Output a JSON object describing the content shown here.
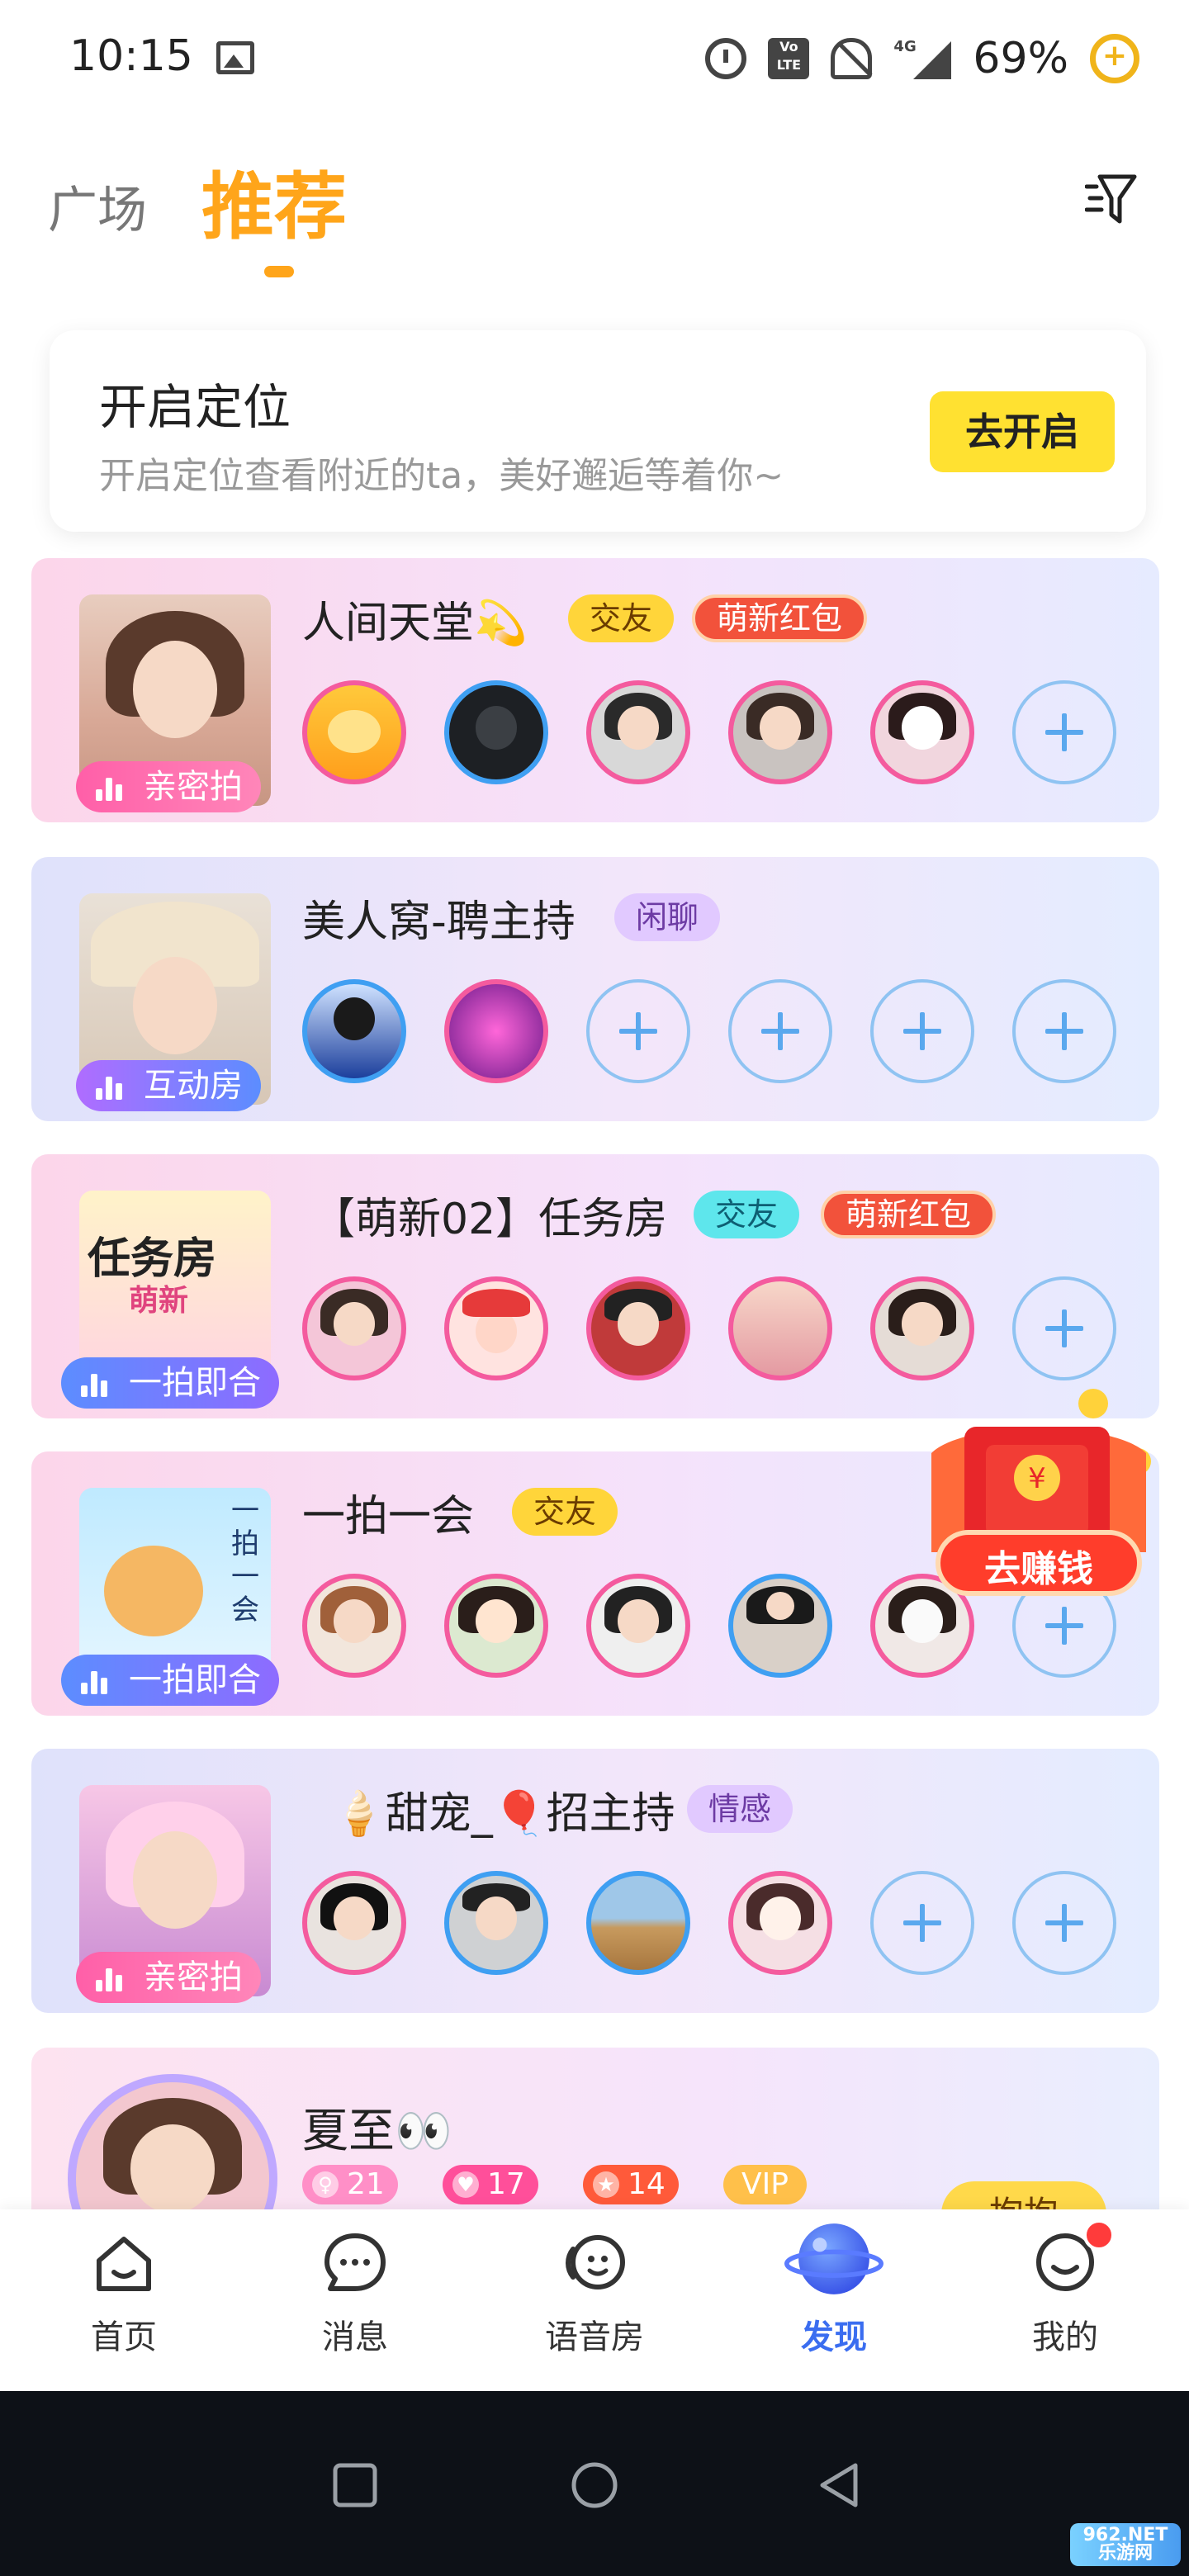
{
  "status_bar": {
    "time": "10:15",
    "battery": "69%",
    "volte_label": "Vo LTE",
    "network_label": "4G"
  },
  "top_tabs": {
    "plaza": "广场",
    "recommended": "推荐"
  },
  "location_card": {
    "title": "开启定位",
    "description": "开启定位查看附近的ta，美好邂逅等着你~",
    "button": "去开启"
  },
  "rooms": [
    {
      "title": "人间天堂💫",
      "cover_tag": "亲密拍",
      "badges": [
        "交友",
        "萌新红包"
      ]
    },
    {
      "title": "美人窝-聘主持",
      "cover_tag": "互动房",
      "badges": [
        "闲聊"
      ]
    },
    {
      "title": "【萌新02】任务房",
      "cover_tag": "一拍即合",
      "badges": [
        "交友",
        "萌新红包"
      ],
      "cover_text": "任务房",
      "cover_subtext": "萌新"
    },
    {
      "title": "一拍一会",
      "cover_tag": "一拍即合",
      "badges": [
        "交友"
      ],
      "cover_text": "一拍一会"
    },
    {
      "title": "🍦甜宠_🎈招主持",
      "cover_tag": "亲密拍",
      "badges": [
        "情感"
      ]
    }
  ],
  "last_card": {
    "title": "夏至👀",
    "stats": {
      "followers": "21",
      "hearts": "17",
      "stars": "14"
    },
    "vip": "VIP",
    "button": "抱抱"
  },
  "red_packet": {
    "label": "去赚钱",
    "coin_symbol": "¥"
  },
  "bottom_nav": [
    {
      "label": "首页",
      "icon": "home-icon"
    },
    {
      "label": "消息",
      "icon": "message-icon"
    },
    {
      "label": "语音房",
      "icon": "voice-room-icon"
    },
    {
      "label": "发现",
      "icon": "discover-planet-icon"
    },
    {
      "label": "我的",
      "icon": "profile-icon"
    }
  ],
  "watermark": {
    "line1": "962.NET",
    "line2": "乐游网"
  },
  "colors": {
    "accent": "#ffa51a",
    "nav_active": "#3a6df0",
    "badge_red": "#f2523b",
    "badge_yellow": "#ffd53a"
  }
}
